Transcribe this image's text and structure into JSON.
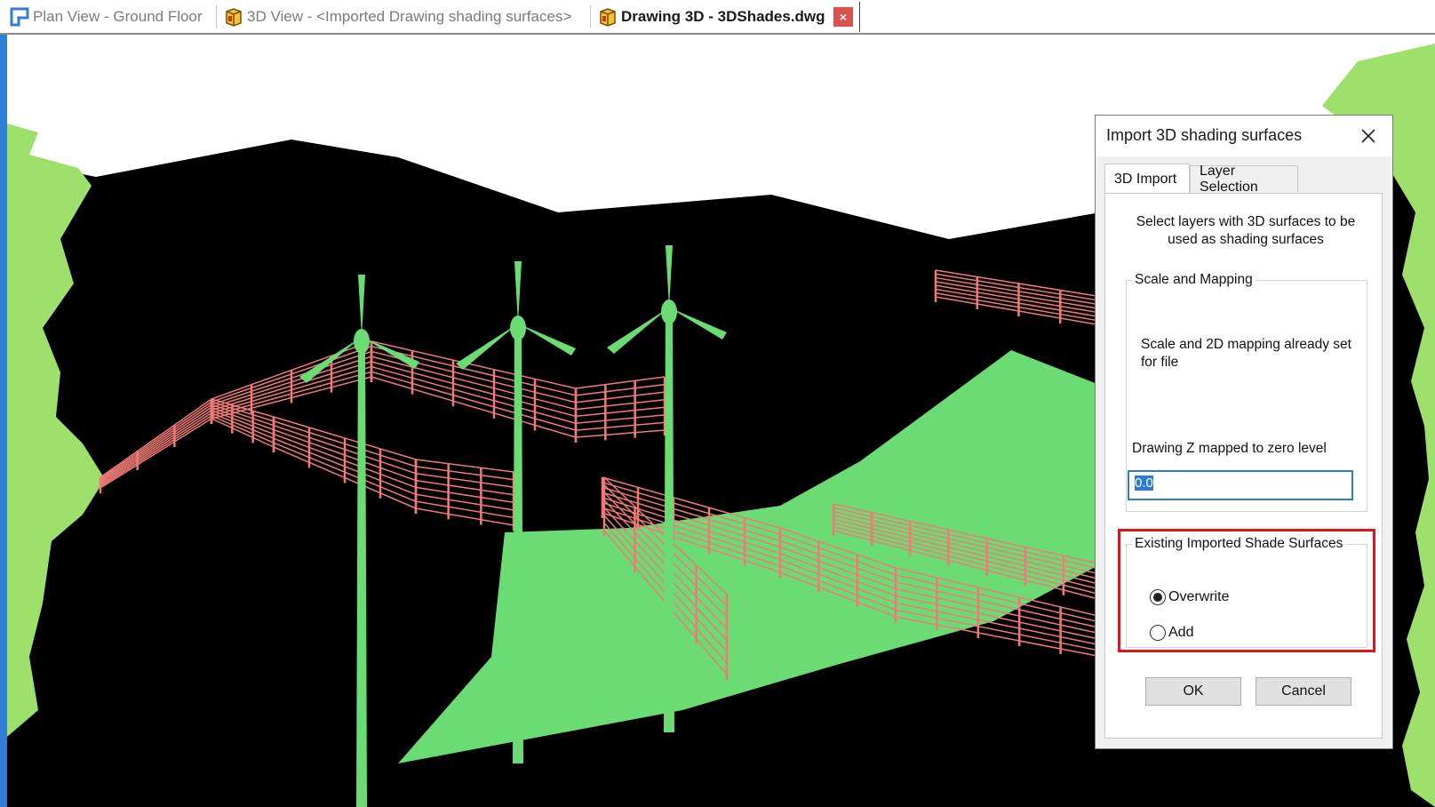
{
  "tabs": [
    {
      "label": "Plan View - Ground Floor",
      "icon": "plan-view-icon",
      "active": false
    },
    {
      "label": "3D View - <Imported Drawing shading surfaces>",
      "icon": "3d-view-icon",
      "active": false
    },
    {
      "label": "Drawing 3D - 3DShades.dwg",
      "icon": "drawing-3d-icon",
      "active": true
    }
  ],
  "tab_close_glyph": "×",
  "colors": {
    "viewport_background": "#000000",
    "terrain": "#9ee06c",
    "shading_surface": "#6bdc74",
    "fences": "#f07b76",
    "tab_close": "#d9534f",
    "highlight": "#e0141a",
    "input_border": "#2a7bd6"
  },
  "dialog": {
    "title": "Import 3D shading surfaces",
    "close_glyph": "✕",
    "tabs": [
      "3D Import",
      "Layer Selection"
    ],
    "instructions": "Select layers with 3D surfaces to be used as shading surfaces",
    "scale_group_title": "Scale and Mapping",
    "scale_info": "Scale and 2D mapping already set for file",
    "zmap_label": "Drawing Z mapped to zero level",
    "zmap_value": "0.0",
    "existing_group_title": "Existing Imported Shade Surfaces",
    "options": {
      "overwrite": {
        "label": "Overwrite",
        "selected": true
      },
      "add": {
        "label": "Add",
        "selected": false
      }
    },
    "ok_label": "OK",
    "cancel_label": "Cancel"
  }
}
